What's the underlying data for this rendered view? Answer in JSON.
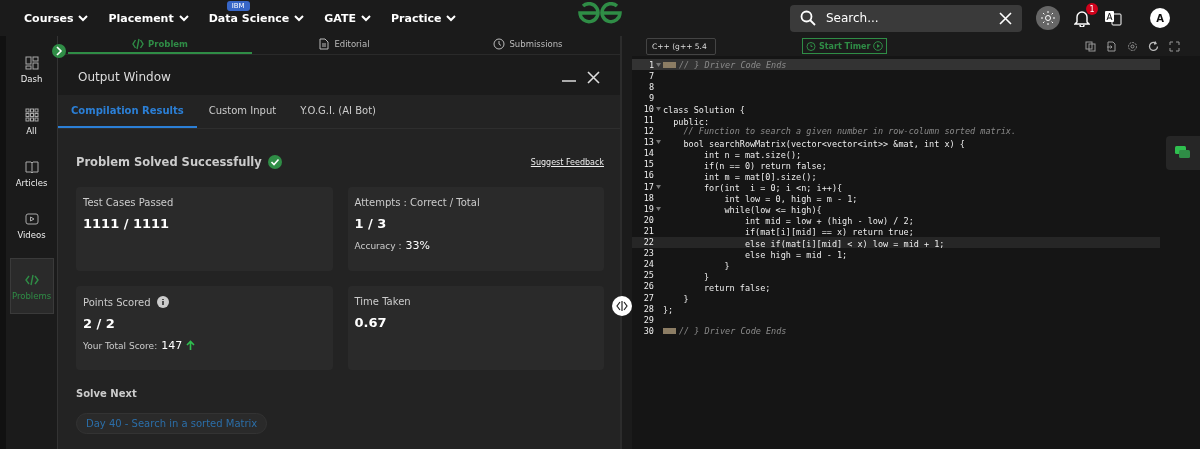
{
  "nav": {
    "items": [
      {
        "label": "Courses"
      },
      {
        "label": "Placement"
      },
      {
        "label": "Data Science",
        "badge": "IBM"
      },
      {
        "label": "GATE"
      },
      {
        "label": "Practice"
      }
    ],
    "search": {
      "placeholder": "Search..."
    },
    "notifications": "1",
    "avatar": "A"
  },
  "sidebar": {
    "items": [
      {
        "label": "Dash",
        "selected": false
      },
      {
        "label": "All",
        "selected": false
      },
      {
        "label": "Articles",
        "selected": false
      },
      {
        "label": "Videos",
        "selected": false
      },
      {
        "label": "Problems",
        "selected": true
      }
    ]
  },
  "problem_tabs": [
    {
      "label": "Problem",
      "selected": true
    },
    {
      "label": "Editorial",
      "selected": false
    },
    {
      "label": "Submissions",
      "selected": false
    }
  ],
  "output_window": {
    "title": "Output Window",
    "tabs": [
      {
        "label": "Compilation Results",
        "selected": true
      },
      {
        "label": "Custom Input",
        "selected": false
      },
      {
        "label": "Y.O.G.I. (AI Bot)",
        "selected": false
      }
    ],
    "status": "Problem Solved Successfully",
    "feedback_link": "Suggest Feedback",
    "cards": [
      {
        "label": "Test Cases Passed",
        "value": "1111 / 1111",
        "info": false,
        "trend_up": false
      },
      {
        "label": "Attempts : Correct / Total",
        "value": "1 / 3",
        "info": false,
        "note_label": "Accuracy :",
        "note_value": "33%",
        "trend_up": false
      },
      {
        "label": "Points Scored",
        "value": "2 / 2",
        "info": true,
        "note_label": "Your Total Score:",
        "note_value": "147",
        "trend_up": true
      },
      {
        "label": "Time Taken",
        "value": "0.67",
        "info": false,
        "trend_up": false
      }
    ],
    "solve_next": {
      "heading": "Solve Next",
      "link": "Day 40 - Search in a sorted Matrix"
    }
  },
  "editor": {
    "language": "C++ (g++ 5.4",
    "timer_button": "Start Timer",
    "lines": [
      {
        "number": "1",
        "text": "// } Driver Code Ends",
        "kind": "folded",
        "fold_toggle": true,
        "highlighted": true
      },
      {
        "number": "7",
        "kind": "code",
        "fold_toggle": false,
        "highlighted": false
      },
      {
        "number": "8",
        "kind": "code",
        "fold_toggle": false,
        "highlighted": false
      },
      {
        "number": "9",
        "kind": "code",
        "fold_toggle": false,
        "highlighted": false
      },
      {
        "number": "10",
        "text": "class Solution {",
        "kind": "code",
        "fold_toggle": true,
        "highlighted": false
      },
      {
        "number": "11",
        "text": "  public:",
        "kind": "code",
        "fold_toggle": false,
        "highlighted": false
      },
      {
        "number": "12",
        "text": "    // Function to search a given number in row-column sorted matrix.",
        "kind": "comment",
        "fold_toggle": false,
        "highlighted": false
      },
      {
        "number": "13",
        "text": "    bool searchRowMatrix(vector<vector<int>> &mat, int x) {",
        "kind": "code",
        "fold_toggle": true,
        "highlighted": false
      },
      {
        "number": "14",
        "text": "        int n = mat.size();",
        "kind": "code",
        "fold_toggle": false,
        "highlighted": false
      },
      {
        "number": "15",
        "text": "        if(n == 0) return false;",
        "kind": "code",
        "fold_toggle": false,
        "highlighted": false
      },
      {
        "number": "16",
        "text": "        int m = mat[0].size();",
        "kind": "code",
        "fold_toggle": false,
        "highlighted": false
      },
      {
        "number": "17",
        "text": "        for(int  i = 0; i <n; i++){",
        "kind": "code",
        "fold_toggle": true,
        "highlighted": false
      },
      {
        "number": "18",
        "text": "            int low = 0, high = m - 1;",
        "kind": "code",
        "fold_toggle": false,
        "highlighted": false
      },
      {
        "number": "19",
        "text": "            while(low <= high){",
        "kind": "code",
        "fold_toggle": true,
        "highlighted": false
      },
      {
        "number": "20",
        "text": "                int mid = low + (high - low) / 2;",
        "kind": "code",
        "fold_toggle": false,
        "highlighted": false
      },
      {
        "number": "21",
        "text": "                if(mat[i][mid] == x) return true;",
        "kind": "code",
        "fold_toggle": false,
        "highlighted": false
      },
      {
        "number": "22",
        "text": "                else if(mat[i][mid] < x) low = mid + 1;",
        "kind": "code",
        "fold_toggle": false,
        "highlighted": true
      },
      {
        "number": "23",
        "text": "                else high = mid - 1;",
        "kind": "code",
        "fold_toggle": false,
        "highlighted": false
      },
      {
        "number": "24",
        "text": "            }",
        "kind": "code",
        "fold_toggle": false,
        "highlighted": false
      },
      {
        "number": "25",
        "text": "        }",
        "kind": "code",
        "fold_toggle": false,
        "highlighted": false
      },
      {
        "number": "26",
        "text": "        return false;",
        "kind": "code",
        "fold_toggle": false,
        "highlighted": false
      },
      {
        "number": "27",
        "text": "    }",
        "kind": "code",
        "fold_toggle": false,
        "highlighted": false
      },
      {
        "number": "28",
        "text": "};",
        "kind": "code",
        "fold_toggle": false,
        "highlighted": false
      },
      {
        "number": "29",
        "kind": "code",
        "fold_toggle": false,
        "highlighted": false
      },
      {
        "number": "30",
        "text": "// } Driver Code Ends",
        "kind": "folded",
        "fold_toggle": false,
        "highlighted": false
      }
    ]
  }
}
